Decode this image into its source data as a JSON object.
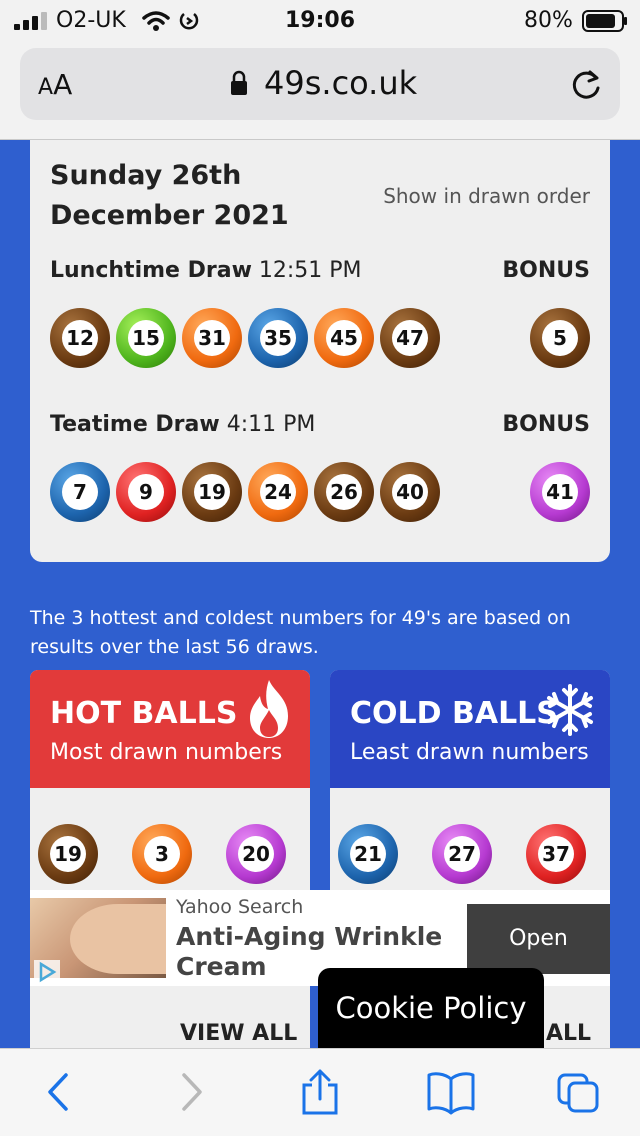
{
  "status_bar": {
    "carrier": "O2-UK",
    "time": "19:06",
    "battery_percent": "80%",
    "icons": [
      "signal-icon",
      "wifi-icon",
      "rotation-lock-icon",
      "battery-icon"
    ]
  },
  "browser": {
    "text_size_label_small": "A",
    "text_size_label_large": "A",
    "url": "49s.co.uk"
  },
  "results": {
    "date": "Sunday 26th December 2021",
    "show_order_link": "Show in drawn order",
    "draws": [
      {
        "name": "Lunchtime Draw",
        "time": "12:51 PM",
        "bonus_label": "BONUS",
        "balls": [
          "12",
          "15",
          "31",
          "35",
          "45",
          "47"
        ],
        "ball_colors": [
          "brown",
          "green",
          "orange",
          "blue",
          "orange",
          "brown"
        ],
        "bonus": "5",
        "bonus_color": "brown"
      },
      {
        "name": "Teatime Draw",
        "time": "4:11 PM",
        "bonus_label": "BONUS",
        "balls": [
          "7",
          "9",
          "19",
          "24",
          "26",
          "40"
        ],
        "ball_colors": [
          "blue",
          "red",
          "brown",
          "orange",
          "brown",
          "brown"
        ],
        "bonus": "41",
        "bonus_color": "purple"
      }
    ]
  },
  "hot_cold_info": "The 3 hottest and coldest numbers for 49's are based on results over the last 56 draws.",
  "hot_panel": {
    "title": "HOT BALLS",
    "subtitle": "Most drawn numbers",
    "balls": [
      "19",
      "3",
      "20"
    ],
    "ball_colors": [
      "brown",
      "orange",
      "purple"
    ],
    "view_all": "VIEW ALL"
  },
  "cold_panel": {
    "title": "COLD BALLS",
    "subtitle": "Least drawn numbers",
    "balls": [
      "21",
      "27",
      "37"
    ],
    "ball_colors": [
      "blue",
      "purple",
      "red"
    ],
    "view_all": "ALL"
  },
  "ad": {
    "source": "Yahoo Search",
    "headline": "Anti-Aging Wrinkle Cream",
    "cta": "Open"
  },
  "cookie_banner": "Cookie Policy",
  "colors": {
    "page_background": "#2f5fcf",
    "hot_header": "#e23a3a",
    "cold_header": "#2a46c4"
  }
}
